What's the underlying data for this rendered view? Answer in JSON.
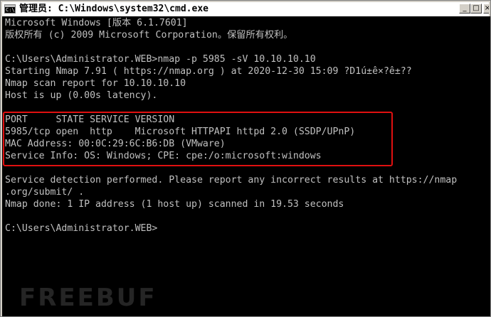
{
  "window": {
    "title": "管理员: C:\\Windows\\system32\\cmd.exe",
    "app_icon": "cmd-icon",
    "app_icon_text": "C:\\",
    "buttons": {
      "minimize": "_",
      "maximize": "□",
      "close": "×"
    }
  },
  "console": {
    "lines": [
      "Microsoft Windows [版本 6.1.7601]",
      "版权所有 (c) 2009 Microsoft Corporation。保留所有权利。",
      "",
      "C:\\Users\\Administrator.WEB>nmap -p 5985 -sV 10.10.10.10",
      "Starting Nmap 7.91 ( https://nmap.org ) at 2020-12-30 15:09 ?D1ú±ê×?ê±??",
      "Nmap scan report for 10.10.10.10",
      "Host is up (0.00s latency).",
      "",
      "PORT     STATE SERVICE VERSION",
      "5985/tcp open  http    Microsoft HTTPAPI httpd 2.0 (SSDP/UPnP)",
      "MAC Address: 00:0C:29:6C:B6:DB (VMware)",
      "Service Info: OS: Windows; CPE: cpe:/o:microsoft:windows",
      "",
      "Service detection performed. Please report any incorrect results at https://nmap",
      ".org/submit/ .",
      "Nmap done: 1 IP address (1 host up) scanned in 19.53 seconds",
      "",
      "C:\\Users\\Administrator.WEB>"
    ]
  },
  "highlight": {
    "color": "#e01010"
  },
  "watermark": {
    "text": "FREEBUF"
  },
  "colors": {
    "console_bg": "#000000",
    "console_fg": "#c0c0c0",
    "titlebar_bg": "#ffffff"
  }
}
